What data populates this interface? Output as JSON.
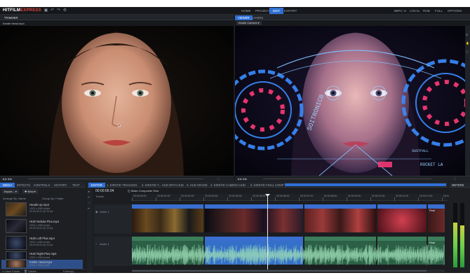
{
  "app": {
    "logo_main": "HITFILM",
    "logo_accent": "EXPRESS",
    "workspace_tabs": [
      "HOME",
      "PROJECT",
      "EDIT",
      "EXPORT"
    ],
    "active_workspace": "EDIT",
    "top_right": {
      "depth": "8BPC: 8",
      "local": "LOCAL",
      "color_mode": "RGB",
      "full": "FULL",
      "options": "OPTIONS"
    }
  },
  "trimmer": {
    "tab": "TRIMMER",
    "clip_name": "Kirstie Head.mp4"
  },
  "viewer": {
    "tabs": [
      "VIEWER",
      "LAYERS"
    ],
    "dropdown": "Kirstie Camera",
    "hud_text": "SOITRONICB",
    "hud_text2": "ROCKET LA",
    "hud_text3": "SUSTFALL"
  },
  "media_panel": {
    "tabs": [
      "MEDIA",
      "EFFECTS",
      "CONTROLS",
      "HISTORY",
      "TEXT"
    ],
    "import_button": "Import...",
    "new_button": "New",
    "arrange_label": "Arrange By: Name",
    "group_label": "Group By: Folder",
    "items": [
      {
        "name": "Heads Up.mp4",
        "meta": [
          "1920 x 1080 pixels",
          "00:00:06:12 @ 25 fps"
        ]
      },
      {
        "name": "HUD Nebula Plus.mp4",
        "meta": [
          "1920 x 1080 pixels",
          "00:00:05:00 @ 25 fps"
        ]
      },
      {
        "name": "HUD Left Plus.mp4",
        "meta": [
          "1920 x 1080 pixels",
          "00:00:05:00 @ 25 fps"
        ]
      },
      {
        "name": "HUD Right Plus.mp4",
        "meta": [
          "1920 x 1080 pixels",
          "00:00:05:00 @ 25 fps"
        ]
      },
      {
        "name": "Kirstie Head.mp4",
        "meta": [
          "1920 x 1080 pixels",
          "00:00:12:00 @ 25 fps"
        ]
      }
    ],
    "new_folder": "New Folder",
    "delete": "Delete",
    "count": "5 item(s)"
  },
  "editor": {
    "tabs": [
      "EDITOR",
      "1. KIRSTIE TRACKING",
      "2. KIRSTIE T... HUD WITH HUD",
      "3. HUD GRADE",
      "4. KIRSTIE CAMERA HUD",
      "5. KIRSTIE FINAL COMP"
    ],
    "timecode": "00:00:06:04",
    "tracks_label": "Tracks",
    "video_track": "Video 1",
    "audio_track": "Audio 1",
    "composite_label": "Make Composite Shot",
    "ruler": [
      "00:00:00:00",
      "00:00:01:00",
      "00:00:02:00",
      "00:00:03:00",
      "00:00:04:00",
      "00:00:05:00",
      "00:00:06:00",
      "00:00:07:00",
      "00:00:08:00",
      "00:00:09:00",
      "00:00:10:00",
      "00:00:11:00",
      "00:00:12:00",
      "00:00:13:00"
    ],
    "video_clips": [
      "Heads Up Final",
      "Heads Up Final",
      "Heads Up Final",
      "Heads Up Final",
      "Heads Up Final"
    ],
    "audio_clips": [
      "Heads Up Final",
      "Heads Up Final",
      "Heads Up Final",
      "Heads Up Final",
      "Heads Up Final"
    ]
  },
  "meters": {
    "tab": "METERS"
  }
}
